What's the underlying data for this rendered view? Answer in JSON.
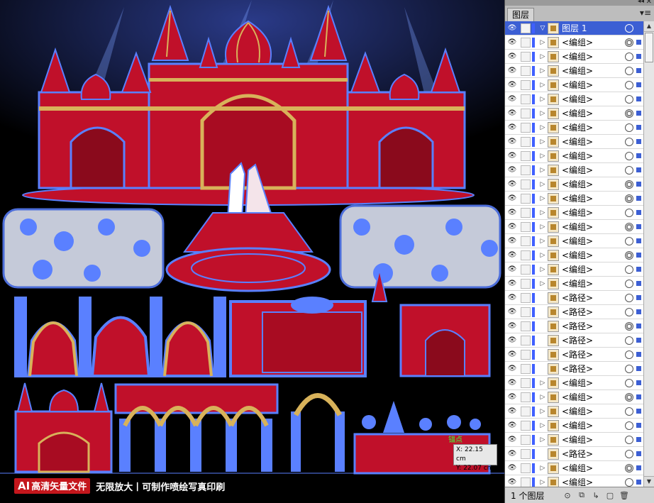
{
  "canvas": {
    "tooltip": {
      "x": "X: 22.15 cm",
      "y": "Y: 22.07 cm"
    },
    "anchor_label": "锚点",
    "banner": {
      "badge": "AI",
      "badge_text": "高清矢量文件",
      "text": "无限放大丨可制作喷绘写真印刷"
    }
  },
  "panel": {
    "tab_label": "图层",
    "collapse_icon": "double-arrow-icon",
    "close_icon": "close-icon",
    "menu_icon": "panel-menu-icon",
    "layers": [
      {
        "name": "图层 1",
        "level": "top",
        "expanded": true
      },
      {
        "name": "<编组>",
        "type": "group"
      },
      {
        "name": "<编组>",
        "type": "group"
      },
      {
        "name": "<编组>",
        "type": "group"
      },
      {
        "name": "<编组>",
        "type": "group"
      },
      {
        "name": "<编组>",
        "type": "group"
      },
      {
        "name": "<编组>",
        "type": "group"
      },
      {
        "name": "<编组>",
        "type": "group"
      },
      {
        "name": "<编组>",
        "type": "group"
      },
      {
        "name": "<编组>",
        "type": "group"
      },
      {
        "name": "<编组>",
        "type": "group"
      },
      {
        "name": "<编组>",
        "type": "group"
      },
      {
        "name": "<编组>",
        "type": "group"
      },
      {
        "name": "<编组>",
        "type": "group"
      },
      {
        "name": "<编组>",
        "type": "group"
      },
      {
        "name": "<编组>",
        "type": "group"
      },
      {
        "name": "<编组>",
        "type": "group"
      },
      {
        "name": "<编组>",
        "type": "group"
      },
      {
        "name": "<编组>",
        "type": "group"
      },
      {
        "name": "<路径>",
        "type": "path"
      },
      {
        "name": "<路径>",
        "type": "path"
      },
      {
        "name": "<路径>",
        "type": "path"
      },
      {
        "name": "<路径>",
        "type": "path"
      },
      {
        "name": "<路径>",
        "type": "path"
      },
      {
        "name": "<路径>",
        "type": "path"
      },
      {
        "name": "<编组>",
        "type": "group"
      },
      {
        "name": "<编组>",
        "type": "group"
      },
      {
        "name": "<编组>",
        "type": "group"
      },
      {
        "name": "<编组>",
        "type": "group"
      },
      {
        "name": "<编组>",
        "type": "group"
      },
      {
        "name": "<路径>",
        "type": "path"
      },
      {
        "name": "<编组>",
        "type": "group"
      },
      {
        "name": "<编组>",
        "type": "group"
      }
    ],
    "footer": {
      "layer_count": "1 个图层"
    }
  },
  "colors": {
    "selection": "#3c5fd4",
    "artwork_red": "#c0102a",
    "outline_blue": "#5a80ff",
    "gold": "#d8b25a"
  }
}
